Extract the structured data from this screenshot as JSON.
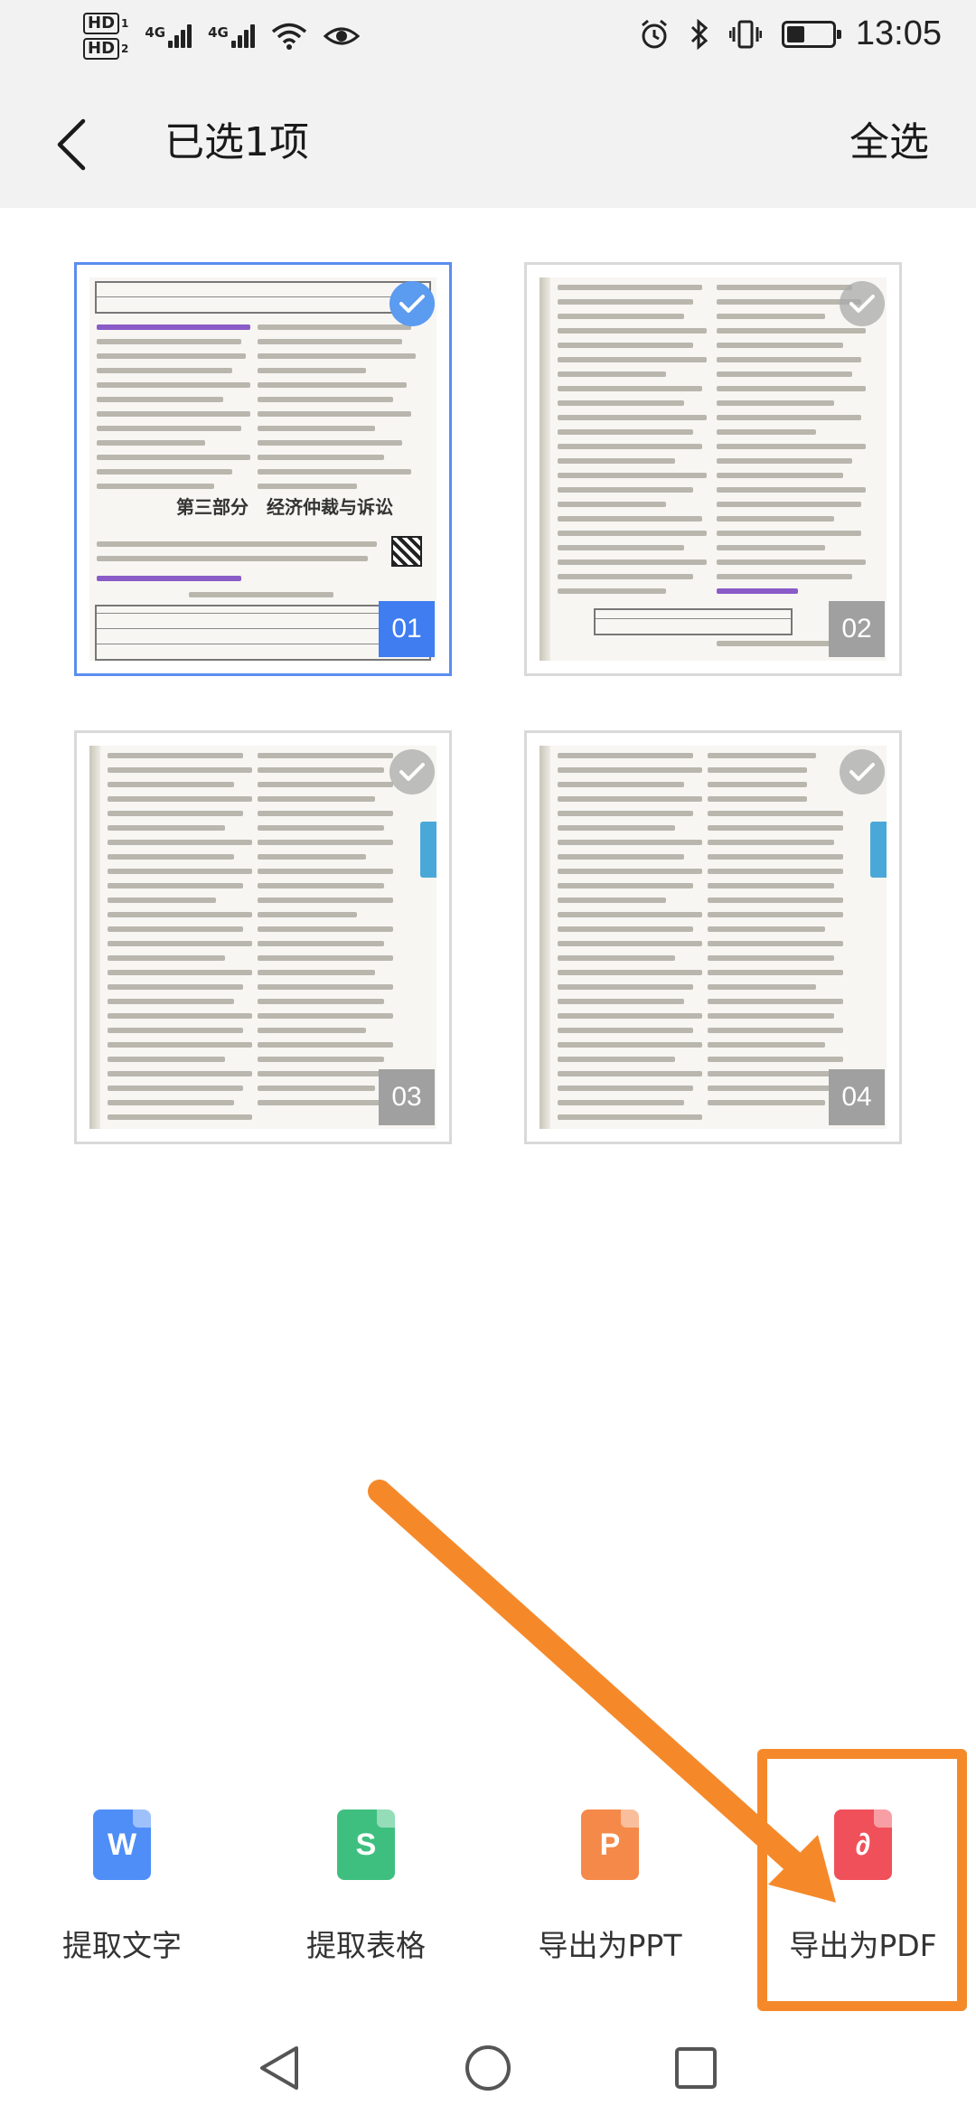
{
  "status_bar": {
    "hd_top": "HD",
    "hd_top_sub": "1",
    "hd_bottom": "HD",
    "hd_bottom_sub": "2",
    "net1": "4G",
    "net2": "4G",
    "time": "13:05",
    "battery_level": 0.4
  },
  "header": {
    "title": "已选1项",
    "select_all": "全选"
  },
  "pages": [
    {
      "number": "01",
      "selected": true,
      "heading": "第三部分　经济仲裁与诉讼"
    },
    {
      "number": "02",
      "selected": false
    },
    {
      "number": "03",
      "selected": false
    },
    {
      "number": "04",
      "selected": false
    }
  ],
  "actions": [
    {
      "label": "提取文字",
      "icon": "word-file-icon",
      "glyph": "W",
      "color": "#4f8ef7"
    },
    {
      "label": "提取表格",
      "icon": "sheet-file-icon",
      "glyph": "S",
      "color": "#3fbf7f"
    },
    {
      "label": "导出为PPT",
      "icon": "ppt-file-icon",
      "glyph": "P",
      "color": "#f5894a"
    },
    {
      "label": "导出为PDF",
      "icon": "pdf-file-icon",
      "glyph": "∂",
      "color": "#f0505a"
    }
  ],
  "colors": {
    "accent": "#3f7df0",
    "annotation": "#f5892a"
  }
}
